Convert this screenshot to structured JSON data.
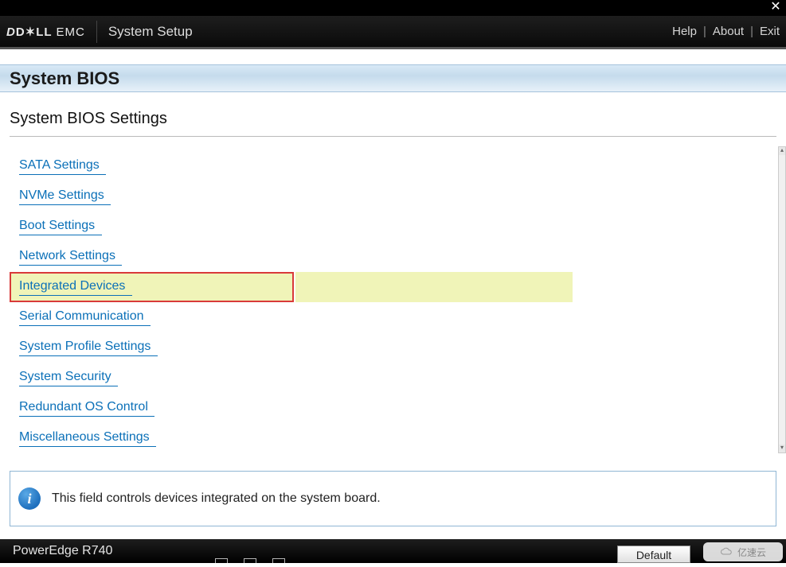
{
  "titlebar": {
    "close_glyph": "✕"
  },
  "header": {
    "brand": "DELL EMC",
    "title": "System Setup",
    "links": {
      "help": "Help",
      "about": "About",
      "exit": "Exit",
      "sep": "|"
    }
  },
  "page": {
    "title": "System BIOS",
    "section_title": "System BIOS Settings"
  },
  "menu": {
    "items": [
      {
        "label": "SATA Settings ",
        "selected": false
      },
      {
        "label": "NVMe Settings ",
        "selected": false
      },
      {
        "label": "Boot Settings ",
        "selected": false
      },
      {
        "label": "Network Settings ",
        "selected": false
      },
      {
        "label": "Integrated Devices ",
        "selected": true
      },
      {
        "label": "Serial Communication ",
        "selected": false
      },
      {
        "label": "System Profile Settings ",
        "selected": false
      },
      {
        "label": "System Security ",
        "selected": false
      },
      {
        "label": "Redundant OS Control ",
        "selected": false
      },
      {
        "label": "Miscellaneous Settings ",
        "selected": false
      }
    ]
  },
  "help_panel": {
    "info_glyph": "i",
    "text": "This field controls devices integrated on the system board."
  },
  "footer": {
    "model": "PowerEdge R740",
    "default_btn": "Default"
  },
  "watermark": {
    "text": "亿速云"
  }
}
